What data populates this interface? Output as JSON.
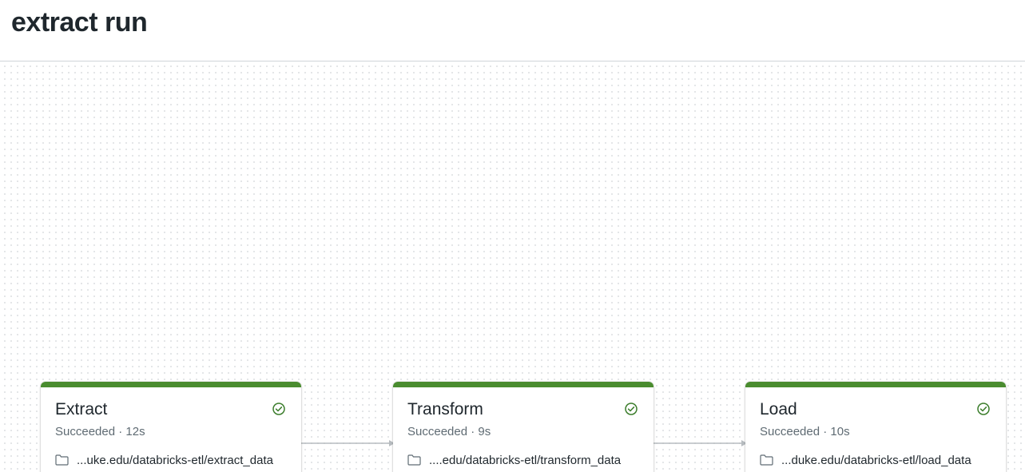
{
  "page": {
    "title": "extract run"
  },
  "colors": {
    "success": "#4a8c2f",
    "edge": "#b7bcc0",
    "success_icon": "#3b7d2b"
  },
  "tasks": [
    {
      "name": "Extract",
      "status": "Succeeded · 12s",
      "path": "...uke.edu/databricks-etl/extract_data",
      "status_icon": "check-circle-icon",
      "path_icon": "folder-icon"
    },
    {
      "name": "Transform",
      "status": "Succeeded · 9s",
      "path": "....edu/databricks-etl/transform_data",
      "status_icon": "check-circle-icon",
      "path_icon": "folder-icon"
    },
    {
      "name": "Load",
      "status": "Succeeded · 10s",
      "path": "...duke.edu/databricks-etl/load_data",
      "status_icon": "check-circle-icon",
      "path_icon": "folder-icon"
    }
  ]
}
